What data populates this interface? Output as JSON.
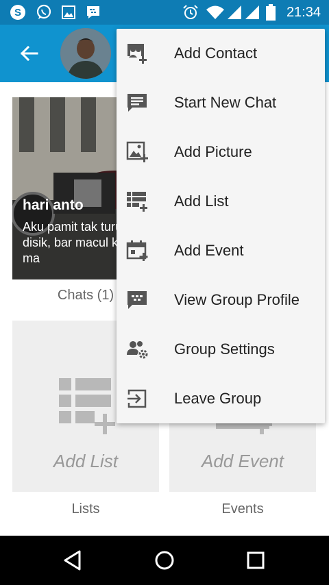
{
  "status_bar": {
    "time": "21:34",
    "left_icons": [
      "skype-icon",
      "whatsapp-icon",
      "image-icon",
      "bbm-icon"
    ],
    "right_icons": [
      "alarm-icon",
      "wifi-icon",
      "signal-icon",
      "signal-icon",
      "battery-icon"
    ]
  },
  "app_bar": {
    "back_icon": "arrow-left-icon",
    "avatar": "group-avatar"
  },
  "chat_tile": {
    "name": "hari anto",
    "message": "Aku pamit tak turu disik, bar macul kesel ma",
    "caption": "Chats (1)"
  },
  "lists_tile": {
    "placeholder": "Add List",
    "caption": "Lists"
  },
  "events_tile": {
    "placeholder": "Add Event",
    "caption": "Events"
  },
  "menu": {
    "items": [
      {
        "label": "Add Contact",
        "icon": "add-contact-icon"
      },
      {
        "label": "Start New Chat",
        "icon": "chat-bubble-icon"
      },
      {
        "label": "Add Picture",
        "icon": "add-picture-icon"
      },
      {
        "label": "Add List",
        "icon": "add-list-icon"
      },
      {
        "label": "Add Event",
        "icon": "add-event-icon"
      },
      {
        "label": "View Group Profile",
        "icon": "group-profile-icon"
      },
      {
        "label": "Group Settings",
        "icon": "group-settings-icon"
      },
      {
        "label": "Leave Group",
        "icon": "leave-group-icon"
      }
    ]
  },
  "nav_bar": {
    "icons": [
      "back-triangle-icon",
      "home-circle-icon",
      "recents-square-icon"
    ]
  },
  "colors": {
    "status_bar": "#0e7cb4",
    "app_bar": "#1093cf",
    "menu_bg": "#f5f5f5",
    "menu_icon": "#555555",
    "tile_bg": "#eeeeee"
  }
}
